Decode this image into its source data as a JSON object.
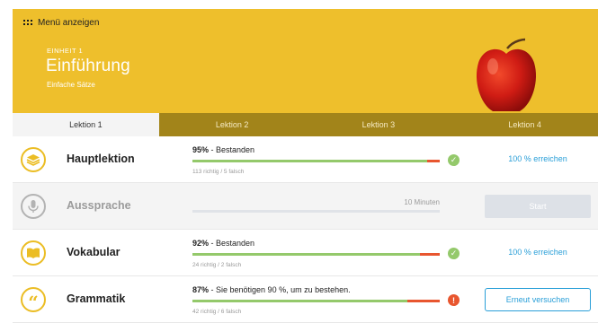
{
  "header": {
    "menu_label": "Menü anzeigen",
    "unit_label": "EINHEIT 1",
    "unit_title": "Einführung",
    "unit_subtitle": "Einfache Sätze",
    "accent_color": "#eebf2c"
  },
  "tabs": [
    {
      "label": "Lektion 1",
      "active": true
    },
    {
      "label": "Lektion 2",
      "active": false
    },
    {
      "label": "Lektion 3",
      "active": false
    },
    {
      "label": "Lektion 4",
      "active": false
    }
  ],
  "lessons": [
    {
      "title": "Hauptlektion",
      "icon": "layers-icon",
      "result_percent": "95%",
      "result_text": " - Bestanden",
      "correct_fraction": 0.95,
      "counts": "113 richtig / 5 falsch",
      "status": "check",
      "action": "100 % erreichen"
    },
    {
      "title": "Aussprache",
      "icon": "microphone-icon",
      "duration": "10 Minuten",
      "action": "Start"
    },
    {
      "title": "Vokabular",
      "icon": "book-icon",
      "result_percent": "92%",
      "result_text": " - Bestanden",
      "correct_fraction": 0.92,
      "counts": "24 richtig / 2 falsch",
      "status": "check",
      "action": "100 % erreichen"
    },
    {
      "title": "Grammatik",
      "icon": "quote-icon",
      "result_percent": "87%",
      "result_text": " - Sie benötigen 90 %, um zu bestehen.",
      "correct_fraction": 0.87,
      "counts": "42 richtig / 6 falsch",
      "status": "alert",
      "action": "Erneut versuchen"
    }
  ]
}
